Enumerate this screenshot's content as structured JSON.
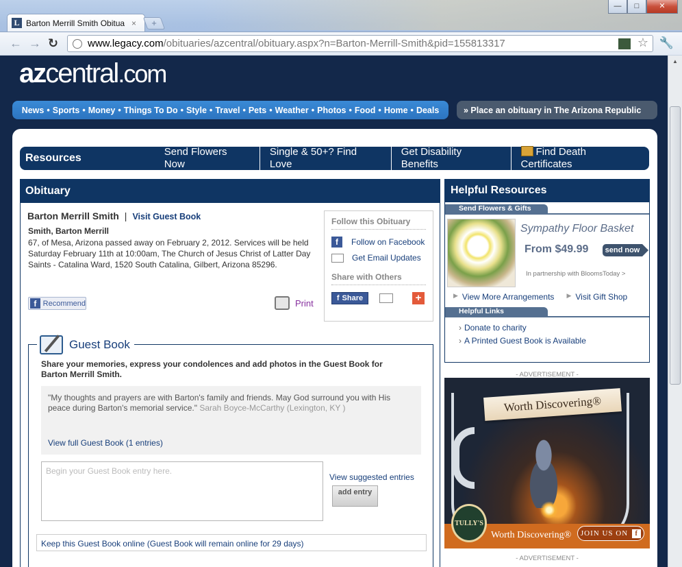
{
  "browser": {
    "tab_title": "Barton Merrill Smith Obitua",
    "tab_favicon": "L",
    "tab_close": "×",
    "new_tab": "+",
    "win_min": "—",
    "win_max": "□",
    "win_close": "✕",
    "back": "←",
    "forward": "→",
    "reload": "↻",
    "url_host": "www.legacy.com",
    "url_path": "/obituaries/azcentral/obituary.aspx?n=Barton-Merrill-Smith&pid=155813317",
    "star": "☆",
    "wrench": "🔧"
  },
  "site": {
    "logo_az": "az",
    "logo_central": "central",
    "logo_tld": ".com",
    "topnav": [
      "News",
      "Sports",
      "Money",
      "Things To Do",
      "Style",
      "Travel",
      "Pets",
      "Weather",
      "Photos",
      "Food",
      "Home",
      "Deals"
    ],
    "place_obit": "» Place an obituary in The Arizona Republic"
  },
  "resources": {
    "title": "Resources",
    "links": [
      "Send Flowers Now",
      "Single & 50+? Find Love",
      "Get Disability Benefits",
      "Find Death Certificates"
    ]
  },
  "obituary": {
    "panel_title": "Obituary",
    "name": "Barton Merrill Smith",
    "separator": "|",
    "guest_book_link": "Visit Guest Book",
    "subname": "Smith, Barton Merrill",
    "text": "67, of Mesa, Arizona passed away on February 2, 2012. Services will be held Saturday February 11th at 10:00am, The Church of Jesus Christ of Latter Day Saints - Catalina Ward, 1520 South Catalina, Gilbert, Arizona 85296.",
    "recommend": "Recommend",
    "print": "Print",
    "follow": {
      "title": "Follow this Obituary",
      "facebook": "Follow on Facebook",
      "email": "Get Email Updates",
      "share_title": "Share with Others",
      "share_btn": "Share",
      "plus": "+"
    }
  },
  "guestbook": {
    "title": "Guest Book",
    "intro": "Share your memories, express your condolences and add photos in the Guest Book for Barton Merrill Smith.",
    "entry_text": "\"My thoughts and prayers are with Barton's family and friends. May God surround you with His peace during Barton's memorial service.\"",
    "entry_author": "Sarah Boyce-McCarthy (Lexington, KY )",
    "view_full": "View full Guest Book (1 entries)",
    "placeholder": "Begin your Guest Book entry here.",
    "suggested": "View suggested entries",
    "add_entry": "add entry",
    "keep_online": "Keep this Guest Book online (Guest Book will remain online for 29 days)"
  },
  "helpful": {
    "title": "Helpful Resources",
    "flowers_head": "Send Flowers & Gifts",
    "flower_name": "Sympathy Floor Basket",
    "flower_price": "From $49.99",
    "send_now": "send now",
    "partner": "In partnership with BloomsToday >",
    "view_more": "View More Arrangements",
    "gift_shop": "Visit Gift Shop",
    "links_head": "Helpful Links",
    "links": [
      "Donate to charity",
      "A Printed Guest Book is Available"
    ]
  },
  "ad": {
    "label": "- ADVERTISEMENT -",
    "banner": "Worth Discovering®",
    "tagline": "Worth Discovering®",
    "join": "JOIN US ON",
    "brand": "TULLY'S",
    "label2": "- ADVERTISEMENT -"
  }
}
